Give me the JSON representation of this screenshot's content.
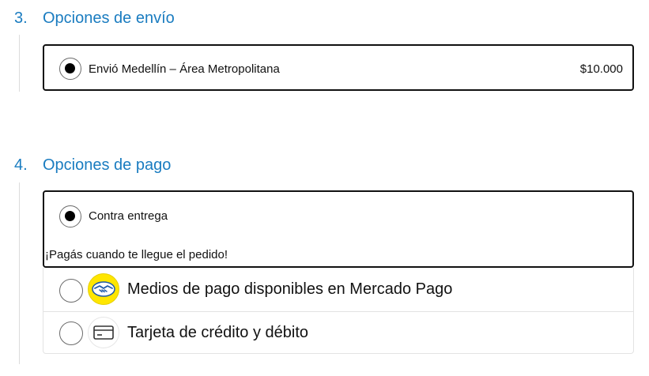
{
  "shipping": {
    "step_number": "3.",
    "title": "Opciones de envío",
    "option_label": "Envió Medellín – Área Metropolitana",
    "option_price": "$10.000",
    "selected": true
  },
  "payment": {
    "step_number": "4.",
    "title": "Opciones de pago",
    "options": [
      {
        "label": "Contra entrega",
        "note": "¡Pagás cuando te llegue el pedido!",
        "selected": true
      },
      {
        "label": "Medios de pago disponibles en Mercado Pago",
        "icon": "mercado-pago-handshake-icon",
        "selected": false
      },
      {
        "label": "Tarjeta de crédito y débito",
        "icon": "credit-card-icon",
        "selected": false
      }
    ]
  },
  "colors": {
    "accent": "#1a7cc0",
    "mercado_pago_yellow": "#ffe600",
    "mercado_pago_blue": "#1f5aa8"
  }
}
